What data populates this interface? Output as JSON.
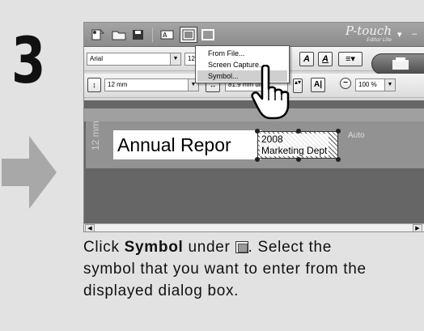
{
  "step": {
    "number": "3"
  },
  "app": {
    "brand": "P-touch",
    "brand_sub": "Editor Lite",
    "window_controls": [
      "▾",
      "–"
    ],
    "font_name": "Arial",
    "font_size_partial": "12",
    "tape_width": "12 mm",
    "label_length_value": "81.9 mm",
    "label_length_mode_partial": "uto)",
    "zoom": "100 %",
    "workspace": {
      "label_length": "12 mm",
      "auto_tag": "Auto",
      "text_annual": "Annual Repor",
      "text_date_line1": "2008",
      "text_date_line2": "Marketing Dept"
    },
    "insert_menu": {
      "items": [
        {
          "label": "From File..."
        },
        {
          "label": "Screen Capture..."
        },
        {
          "label": "Symbol..."
        }
      ],
      "active_index": 2
    }
  },
  "instruction": {
    "part1": "Click ",
    "bold": "Symbol",
    "part2": " under ",
    "part3": ". Select the",
    "line2": "symbol that you want to enter from the",
    "line3": "displayed dialog box."
  },
  "colors": {
    "background": "#e2e2e2",
    "title_bar": "#939393",
    "workspace": "#666666",
    "arrow": "#a8a8a8"
  }
}
